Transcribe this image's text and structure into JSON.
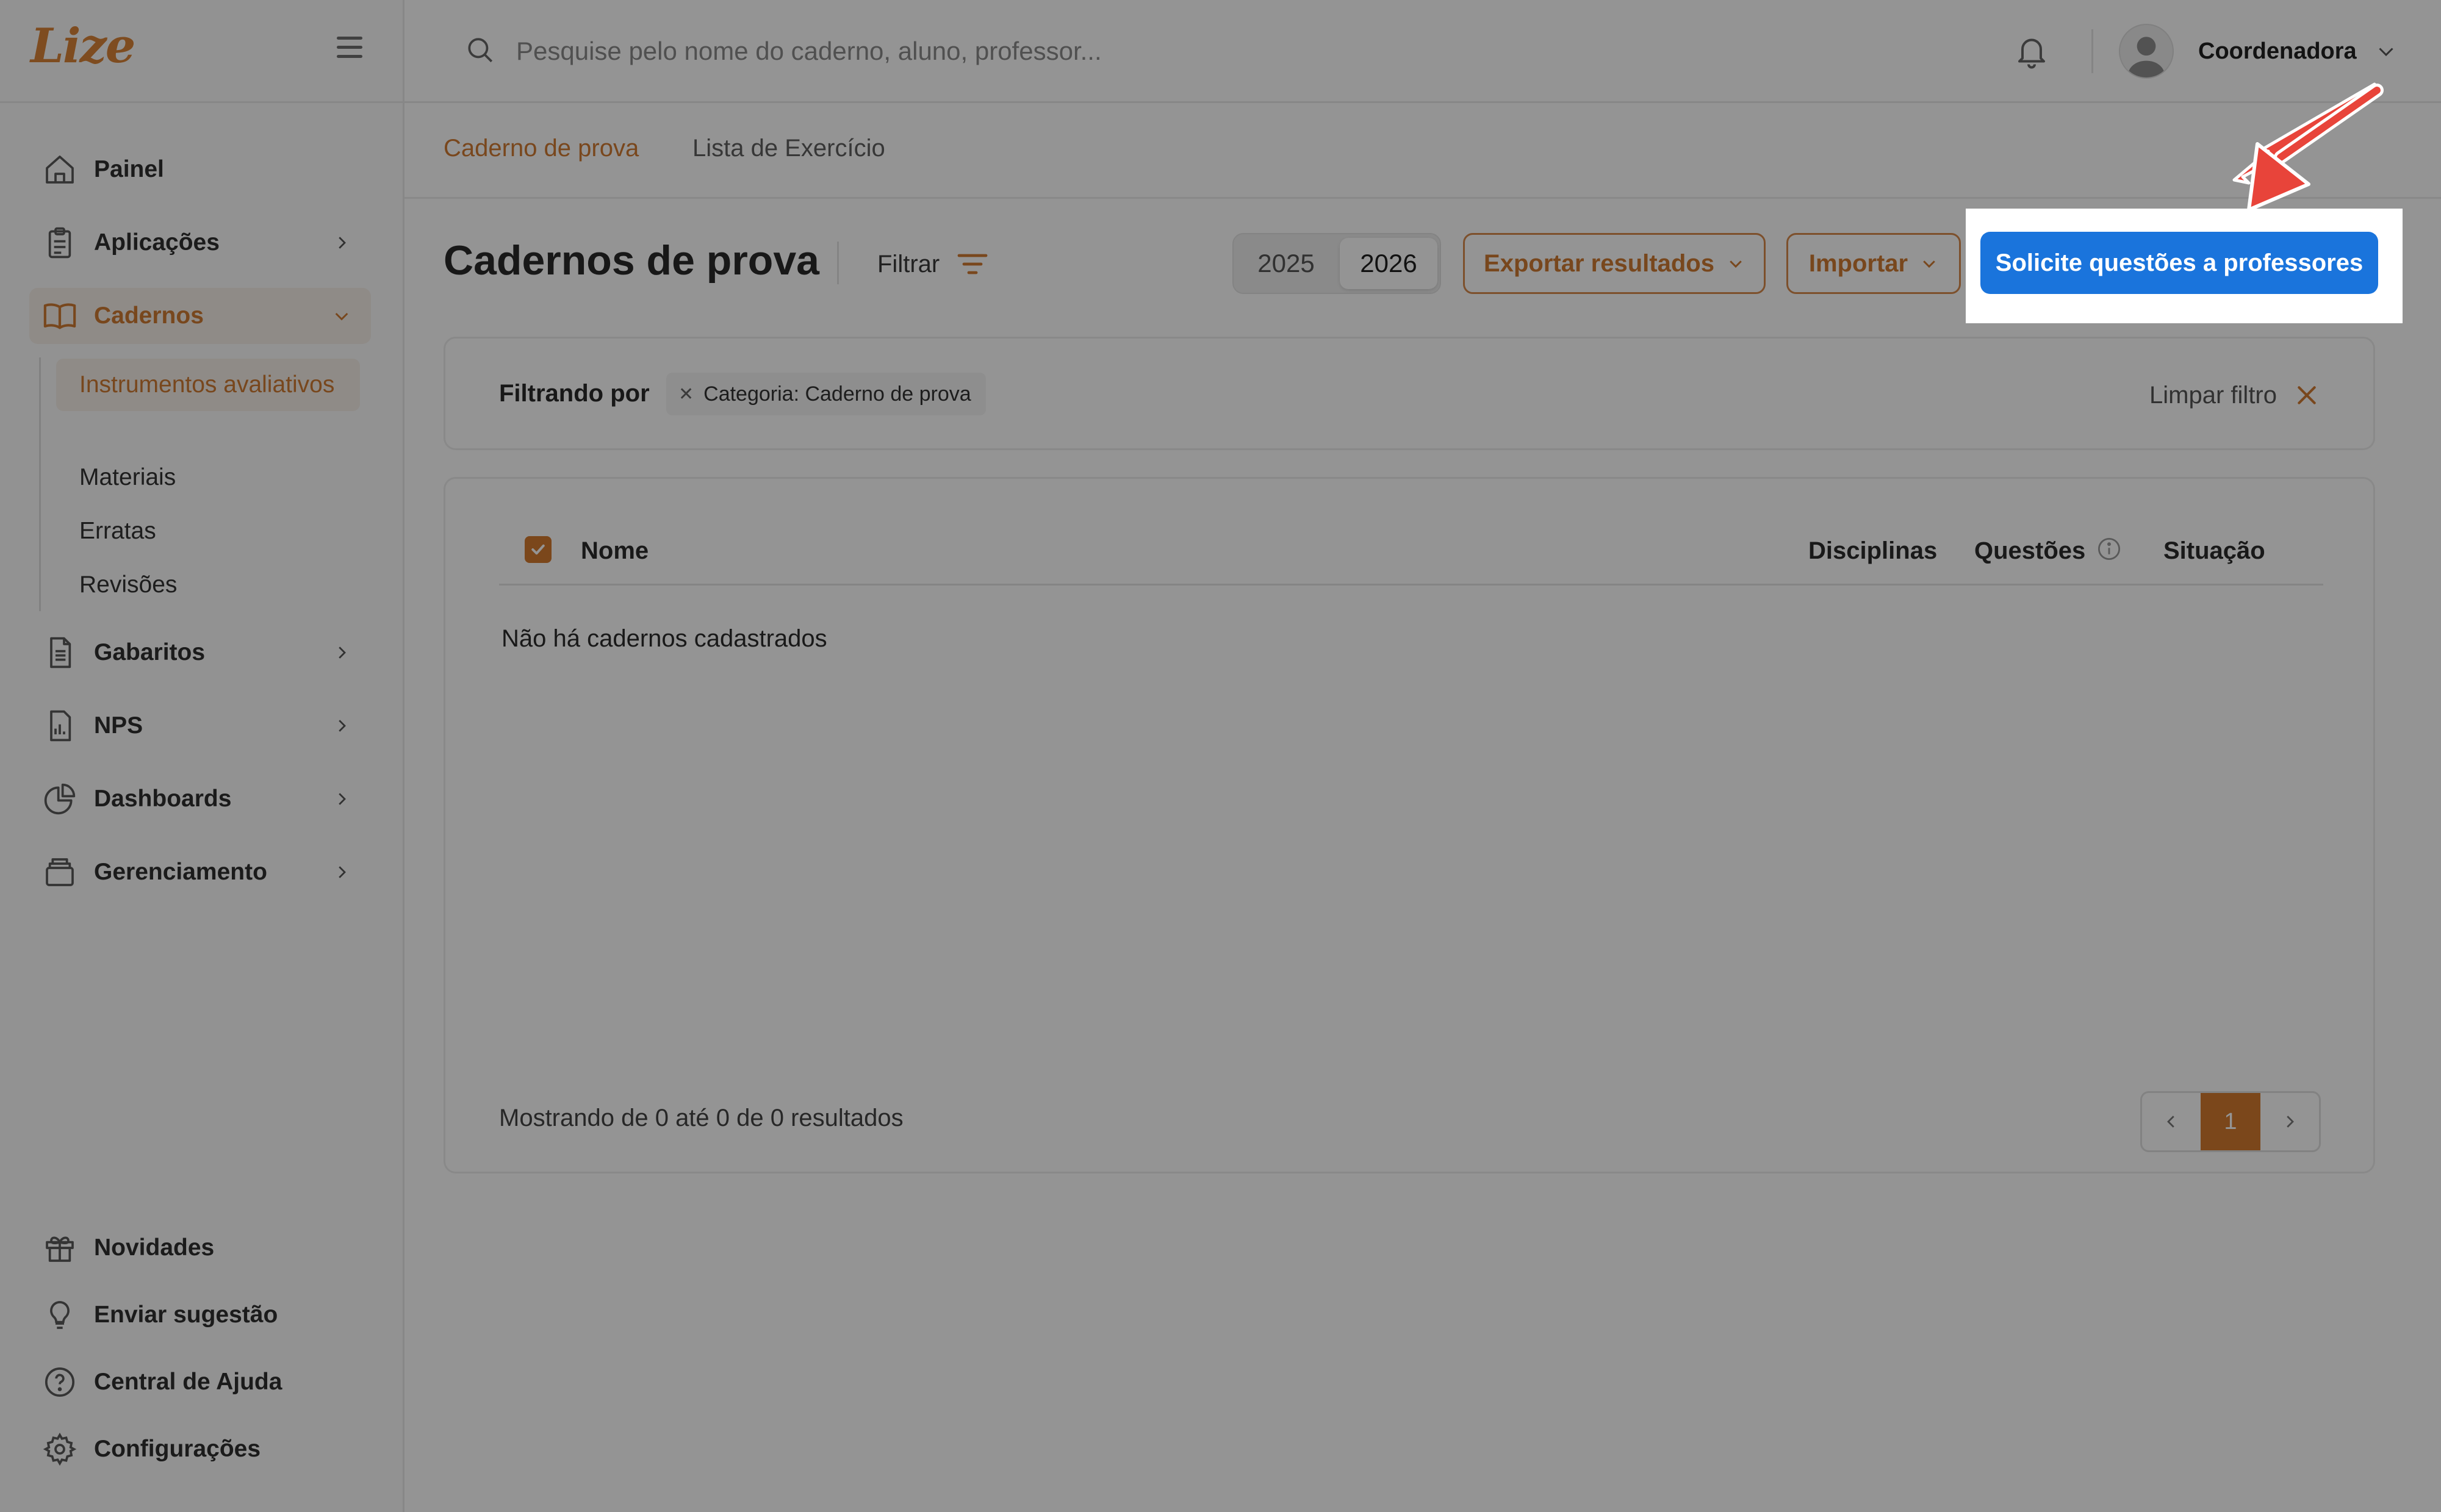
{
  "app": {
    "logo_text": "Lize"
  },
  "sidebar": {
    "main_items": [
      {
        "label": "Painel",
        "icon": "home-icon"
      },
      {
        "label": "Aplicações",
        "icon": "clipboard-icon"
      },
      {
        "label": "Cadernos",
        "icon": "book-icon",
        "active": true
      },
      {
        "label": "Gabaritos",
        "icon": "answer-sheet-icon"
      },
      {
        "label": "NPS",
        "icon": "bar-chart-icon"
      },
      {
        "label": "Dashboards",
        "icon": "pie-chart-icon"
      },
      {
        "label": "Gerenciamento",
        "icon": "archive-icon"
      }
    ],
    "cadernos_subitems": [
      {
        "label": "Instrumentos avaliativos",
        "active": true
      },
      {
        "label": "Materiais"
      },
      {
        "label": "Erratas"
      },
      {
        "label": "Revisões"
      }
    ],
    "bottom_items": [
      {
        "label": "Novidades",
        "icon": "gift-icon"
      },
      {
        "label": "Enviar sugestão",
        "icon": "lightbulb-icon"
      },
      {
        "label": "Central de Ajuda",
        "icon": "help-icon"
      },
      {
        "label": "Configurações",
        "icon": "gear-icon"
      }
    ]
  },
  "header": {
    "search_placeholder": "Pesquise pelo nome do caderno, aluno, professor...",
    "user_name": "Coordenadora"
  },
  "tabs": [
    {
      "label": "Caderno de prova",
      "active": true
    },
    {
      "label": "Lista de Exercício",
      "active": false
    }
  ],
  "page": {
    "title": "Cadernos de prova",
    "filter_label": "Filtrar",
    "years": [
      "2025",
      "2026"
    ],
    "selected_year": "2026",
    "export_label": "Exportar resultados",
    "import_label": "Importar",
    "primary_action": "Solicite questões a professores"
  },
  "filter_bar": {
    "label": "Filtrando por",
    "chips": [
      "Categoria: Caderno de prova"
    ],
    "clear_label": "Limpar filtro"
  },
  "table": {
    "columns": {
      "name": "Nome",
      "subjects": "Disciplinas",
      "questions": "Questões",
      "status": "Situação"
    },
    "empty_message": "Não há cadernos cadastrados",
    "results_text": "Mostrando de 0 até 0 de 0 resultados",
    "current_page": "1"
  },
  "colors": {
    "accent": "#d17b33",
    "primary_button": "#1a74dc",
    "annotation_arrow": "#e8443a"
  }
}
